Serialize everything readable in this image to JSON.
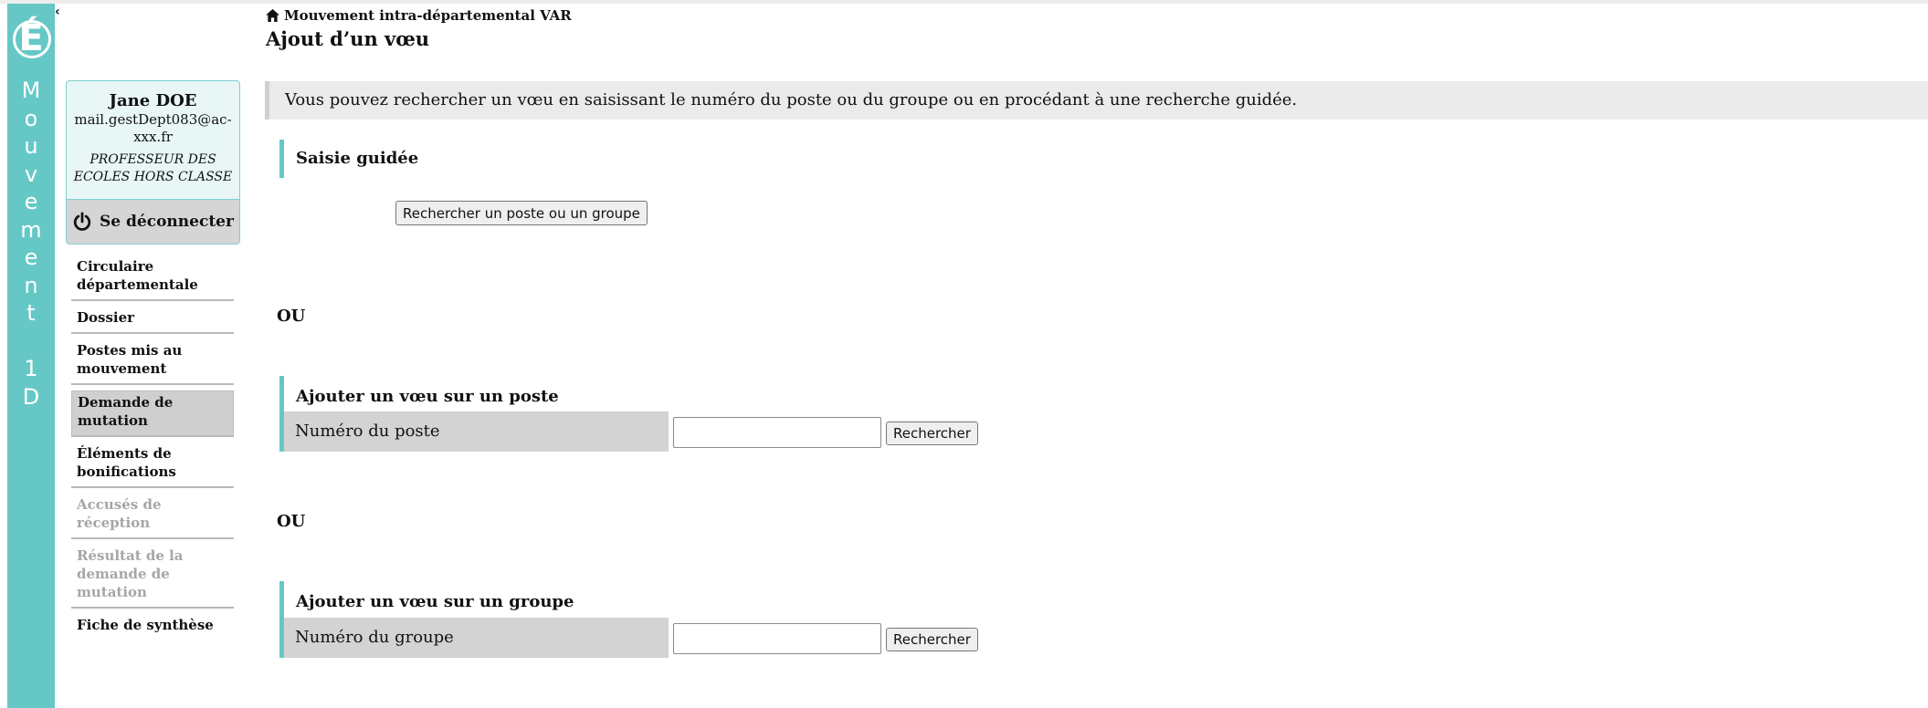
{
  "brand": {
    "logo_letter": "É",
    "vertical_title_chars": [
      "M",
      "o",
      "u",
      "v",
      "e",
      "m",
      "e",
      "n",
      "t",
      " ",
      "1",
      "D"
    ],
    "color": "#65c8c6"
  },
  "user": {
    "name": "Jane DOE",
    "email": "mail.gestDept083@ac-xxx.fr",
    "role": "PROFESSEUR DES ECOLES HORS CLASSE",
    "logout_label": "Se déconnecter",
    "logout_icon": "power-icon"
  },
  "nav": {
    "items": [
      {
        "label": "Circulaire départementale",
        "state": "normal"
      },
      {
        "label": "Dossier",
        "state": "normal"
      },
      {
        "label": "Postes mis au mouvement",
        "state": "normal"
      },
      {
        "label": "Demande de mutation",
        "state": "active"
      },
      {
        "label": "Éléments de bonifications",
        "state": "normal"
      },
      {
        "label": "Accusés de réception",
        "state": "disabled"
      },
      {
        "label": "Résultat de la demande de mutation",
        "state": "disabled"
      },
      {
        "label": "Fiche de synthèse",
        "state": "normal"
      }
    ]
  },
  "header": {
    "breadcrumb_icon": "home-icon",
    "breadcrumb": "Mouvement intra-départemental VAR",
    "title": "Ajout d’un vœu"
  },
  "main": {
    "info_text": "Vous pouvez rechercher un vœu en saisissant le numéro du poste ou du groupe ou en procédant à une recherche guidée.",
    "guided": {
      "heading": "Saisie guidée",
      "button": "Rechercher un poste ou un groupe"
    },
    "or_label": "OU",
    "post": {
      "heading": "Ajouter un vœu sur un poste",
      "field_label": "Numéro du poste",
      "input_value": "",
      "button": "Rechercher"
    },
    "group": {
      "heading": "Ajouter un vœu sur un groupe",
      "field_label": "Numéro du groupe",
      "input_value": "",
      "button": "Rechercher"
    }
  }
}
